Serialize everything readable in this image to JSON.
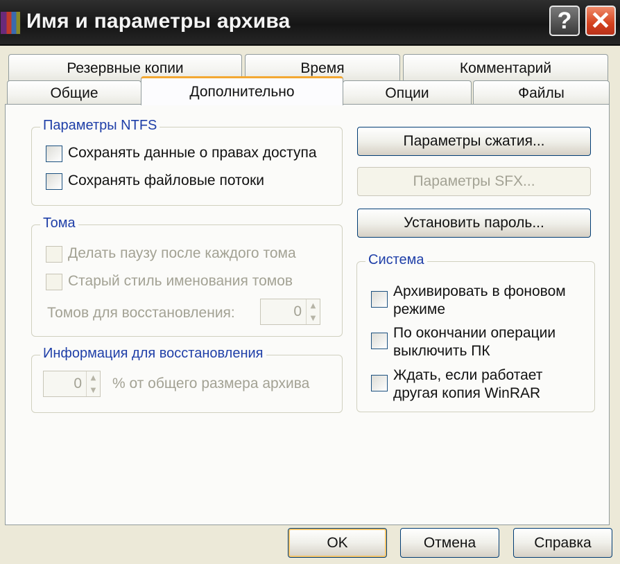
{
  "window": {
    "title": "Имя и параметры архива",
    "help_symbol": "?",
    "close_symbol": "✕"
  },
  "tabs": {
    "row1": [
      "Резервные копии",
      "Время",
      "Комментарий"
    ],
    "row2": [
      "Общие",
      "Дополнительно",
      "Опции",
      "Файлы"
    ],
    "active": "Дополнительно"
  },
  "ntfs": {
    "title": "Параметры NTFS",
    "opt1": "Сохранять данные о правах доступа",
    "opt2": "Сохранять файловые потоки"
  },
  "volumes": {
    "title": "Тома",
    "opt1": "Делать паузу после каждого тома",
    "opt2": "Старый стиль именования томов",
    "recovery_label": "Томов для восстановления:",
    "recovery_value": "0"
  },
  "recovery_info": {
    "title": "Информация для восстановления",
    "value": "0",
    "suffix": "% от общего размера архива"
  },
  "buttons": {
    "compression": "Параметры сжатия...",
    "sfx": "Параметры SFX...",
    "password": "Установить пароль...",
    "ok": "OK",
    "cancel": "Отмена",
    "help": "Справка"
  },
  "system": {
    "title": "Система",
    "opt1": "Архивировать в фоновом режиме",
    "opt2": "По окончании операции выключить ПК",
    "opt3": "Ждать, если работает другая копия WinRAR"
  }
}
